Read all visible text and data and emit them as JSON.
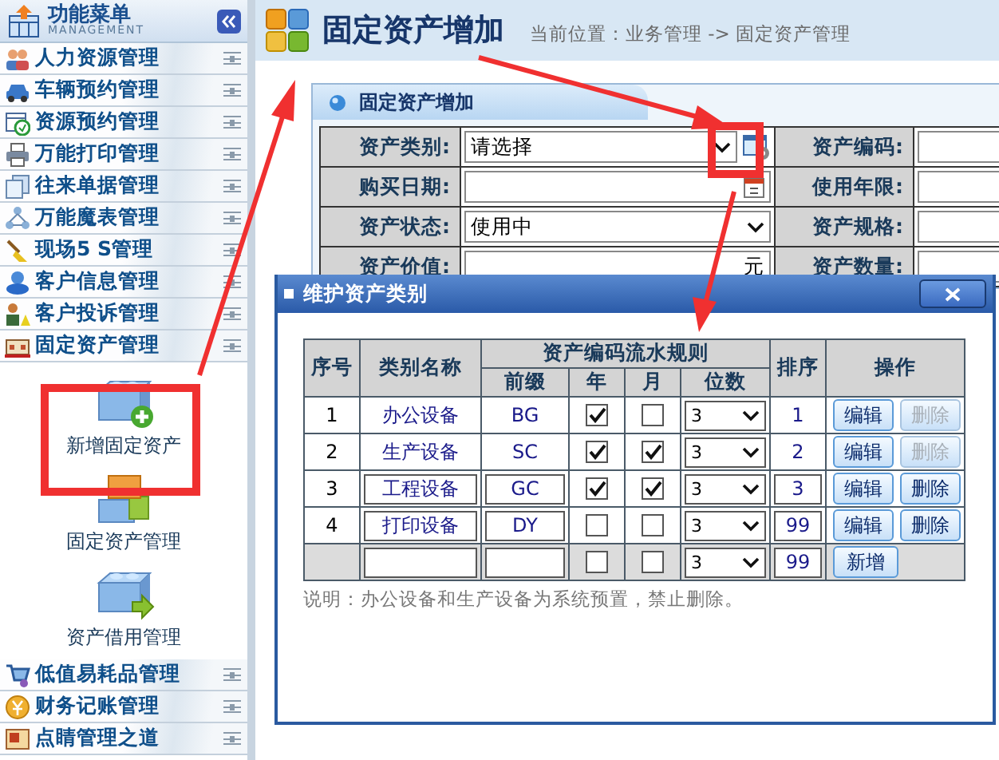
{
  "sidebar": {
    "title": "功能菜单",
    "subtitle": "MANAGEMENT",
    "items": [
      {
        "label": "人力资源管理"
      },
      {
        "label": "车辆预约管理"
      },
      {
        "label": "资源预约管理"
      },
      {
        "label": "万能打印管理"
      },
      {
        "label": "往来单据管理"
      },
      {
        "label": "万能魔表管理"
      },
      {
        "label": "现场5 S管理"
      },
      {
        "label": "客户信息管理"
      },
      {
        "label": "客户投诉管理"
      },
      {
        "label": "固定资产管理",
        "children": [
          {
            "label": "新增固定资产"
          },
          {
            "label": "固定资产管理"
          },
          {
            "label": "资产借用管理"
          }
        ]
      },
      {
        "label": "低值易耗品管理"
      },
      {
        "label": "财务记账管理"
      },
      {
        "label": "点睛管理之道"
      }
    ]
  },
  "header": {
    "title": "固定资产增加",
    "breadcrumb": "当前位置：业务管理  -> 固定资产管理"
  },
  "form": {
    "title": "固定资产增加",
    "rows": [
      {
        "left": {
          "label": "资产类别:",
          "kind": "select",
          "value": "请选择"
        },
        "right": {
          "label": "资产编码:"
        }
      },
      {
        "left": {
          "label": "购买日期:",
          "kind": "date"
        },
        "right": {
          "label": "使用年限:"
        }
      },
      {
        "left": {
          "label": "资产状态:",
          "kind": "select",
          "value": "使用中"
        },
        "right": {
          "label": "资产规格:"
        }
      },
      {
        "left": {
          "label": "资产价值:",
          "kind": "money",
          "unit": "元"
        },
        "right": {
          "label": "资产数量:"
        }
      }
    ]
  },
  "dialog": {
    "title": "维护资产类别",
    "columns": [
      "序号",
      "类别名称",
      "资产编码流水规则",
      "前缀",
      "年",
      "月",
      "位数",
      "排序",
      "操作"
    ],
    "rows": [
      {
        "kind": "preset",
        "index": "1",
        "name": "办公设备",
        "prefix": "BG",
        "year": true,
        "month": false,
        "digits": "3",
        "sort": "1",
        "actions": [
          {
            "label": "编辑",
            "disabled": false
          },
          {
            "label": "删除",
            "disabled": true
          }
        ]
      },
      {
        "kind": "preset",
        "index": "2",
        "name": "生产设备",
        "prefix": "SC",
        "year": true,
        "month": true,
        "digits": "3",
        "sort": "2",
        "actions": [
          {
            "label": "编辑",
            "disabled": false
          },
          {
            "label": "删除",
            "disabled": true
          }
        ]
      },
      {
        "kind": "editable",
        "index": "3",
        "name": "工程设备",
        "prefix": "GC",
        "year": true,
        "month": true,
        "digits": "3",
        "sort": "3",
        "actions": [
          {
            "label": "编辑",
            "disabled": false
          },
          {
            "label": "删除",
            "disabled": false
          }
        ]
      },
      {
        "kind": "editable",
        "index": "4",
        "name": "打印设备",
        "prefix": "DY",
        "year": false,
        "month": false,
        "digits": "3",
        "sort": "99",
        "actions": [
          {
            "label": "编辑",
            "disabled": false
          },
          {
            "label": "删除",
            "disabled": false
          }
        ]
      },
      {
        "kind": "new",
        "year": false,
        "month": false,
        "digits": "3",
        "sort": "99",
        "actions": [
          {
            "label": "新增",
            "disabled": false
          }
        ]
      }
    ],
    "note": "说明：办公设备和生产设备为系统预置，禁止删除。"
  }
}
